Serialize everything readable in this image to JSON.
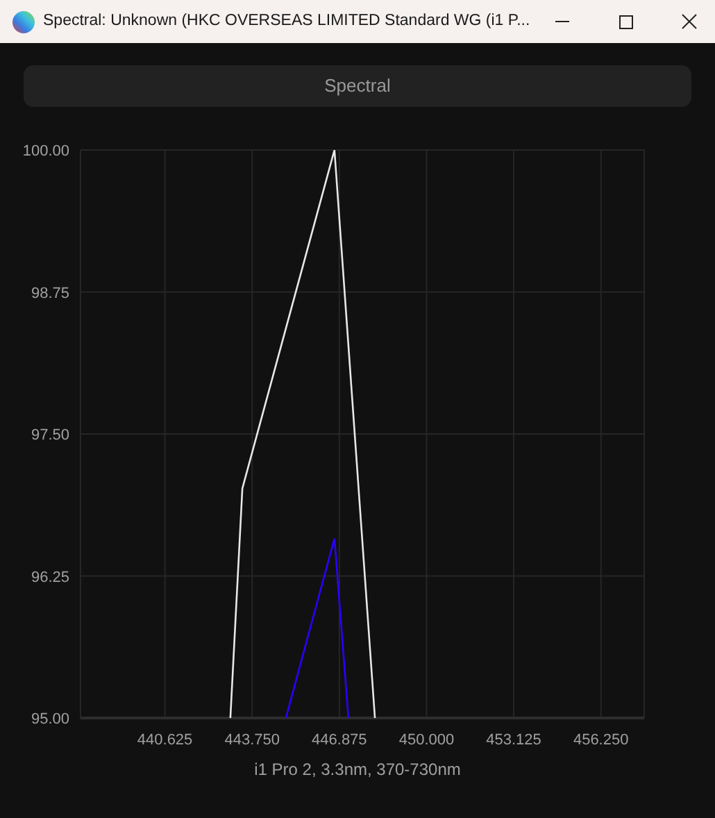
{
  "window": {
    "title": "Spectral: Unknown (HKC OVERSEAS LIMITED Standard WG (i1 P..."
  },
  "mode_button": {
    "label": "Spectral"
  },
  "chart_data": {
    "type": "line",
    "grid": true,
    "x": [
      442.97,
      443.4,
      444.96,
      446.7,
      447.2,
      448.15
    ],
    "series": [
      {
        "color": "#e8e8e8",
        "values": [
          95,
          97.02,
          98.43,
          100,
          98.28,
          95
        ]
      },
      {
        "color": "#2a00ff",
        "values": [
          null,
          null,
          95,
          96.58,
          95,
          null
        ]
      }
    ],
    "xlim": [
      437.6,
      457.8
    ],
    "ylim": [
      95,
      100
    ],
    "xticks": [
      {
        "value": 440.625,
        "label": "440.625"
      },
      {
        "value": 443.75,
        "label": "443.750"
      },
      {
        "value": 446.875,
        "label": "446.875"
      },
      {
        "value": 450,
        "label": "450.000"
      },
      {
        "value": 453.125,
        "label": "453.125"
      },
      {
        "value": 456.25,
        "label": "456.250"
      }
    ],
    "yticks": [
      {
        "value": 95,
        "label": "95.00"
      },
      {
        "value": 96.25,
        "label": "96.25"
      },
      {
        "value": 97.5,
        "label": "97.50"
      },
      {
        "value": 98.75,
        "label": "98.75"
      },
      {
        "value": 100,
        "label": "100.00"
      }
    ]
  },
  "caption": "i1 Pro 2, 3.3nm, 370-730nm"
}
